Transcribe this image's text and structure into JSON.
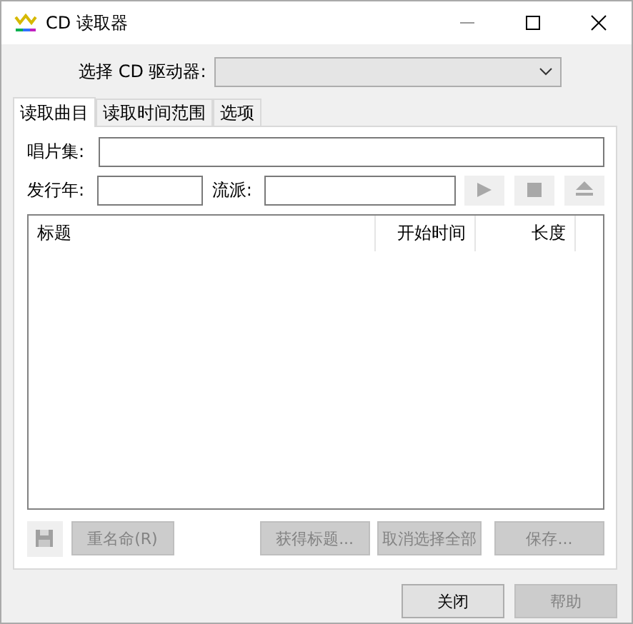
{
  "window": {
    "title": "CD 读取器"
  },
  "drive": {
    "label": "选择 CD 驱动器:"
  },
  "tabs": [
    {
      "label": "读取曲目",
      "selected": true
    },
    {
      "label": "读取时间范围",
      "selected": false
    },
    {
      "label": "选项",
      "selected": false
    }
  ],
  "album": {
    "label": "唱片集:"
  },
  "year": {
    "label": "发行年:"
  },
  "genre": {
    "label": "流派:"
  },
  "transport": [
    {
      "kind": "play",
      "disabled": true
    },
    {
      "kind": "stop",
      "disabled": true
    },
    {
      "kind": "eject",
      "disabled": true
    }
  ],
  "table": {
    "columns": [
      {
        "label": "标题"
      },
      {
        "label": "开始时间"
      },
      {
        "label": "长度"
      }
    ]
  },
  "save_icon": {
    "disabled": true
  },
  "actions": [
    {
      "label": "重名命(R)",
      "disabled": true
    },
    {
      "label": "获得标题...",
      "disabled": true
    },
    {
      "label": "取消选择全部",
      "disabled": true
    },
    {
      "label": "保存...",
      "disabled": true
    }
  ],
  "dialog_buttons": [
    {
      "label": "关闭",
      "disabled": false
    },
    {
      "label": "帮助",
      "disabled": true
    }
  ]
}
